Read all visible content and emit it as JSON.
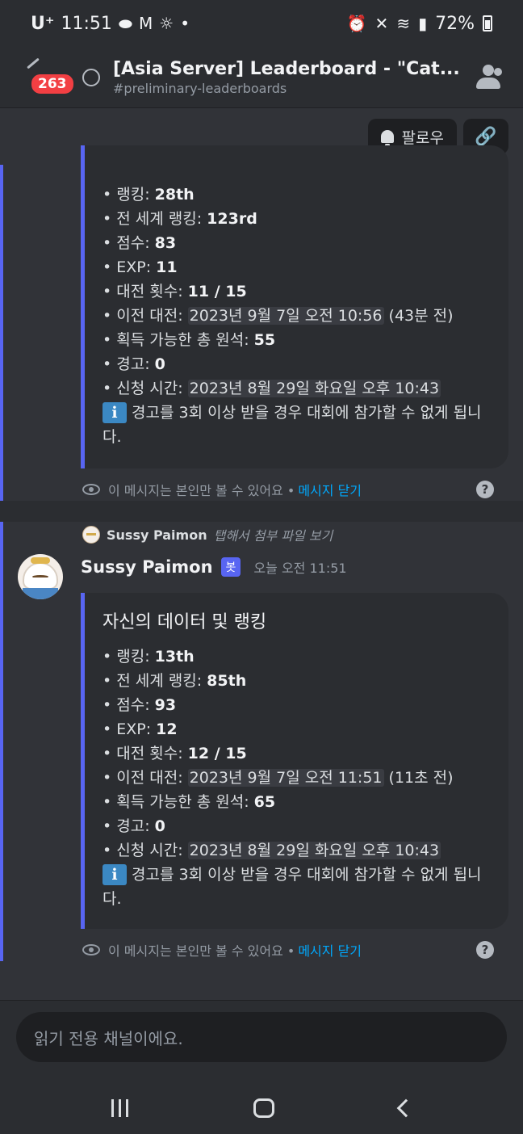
{
  "status": {
    "carrier": "U⁺",
    "time": "11:51",
    "battery": "72%"
  },
  "header": {
    "badge_count": "263",
    "title": "[Asia Server] Leaderboard - \"Cat...",
    "subtitle": "#preliminary-leaderboards"
  },
  "follow_bar": {
    "follow_label": "팔로우",
    "link_icon": "link-icon"
  },
  "message1": {
    "fields": [
      {
        "label": "• 랭킹: ",
        "value": "28th"
      },
      {
        "label": "• 전 세계 랭킹: ",
        "value": "123rd"
      },
      {
        "label": "• 점수: ",
        "value": "83"
      },
      {
        "label": "• EXP: ",
        "value": "11"
      },
      {
        "label": "• 대전 횟수: ",
        "value": "11 / 15"
      }
    ],
    "prev_match_label": "• 이전 대전: ",
    "prev_match_ts": "2023년 9월 7일 오전 10:56",
    "prev_match_rel": " (43분 전)",
    "primo_label": "• 획득 가능한 총 원석: ",
    "primo_value": "55",
    "warn_label": "• 경고: ",
    "warn_value": "0",
    "signup_label": "• 신청 시간: ",
    "signup_ts": "2023년 8월 29일 화요일 오후 10:43",
    "info_text": "경고를 3회 이상 받을 경우 대회에 참가할 수 없게 됩니다.",
    "ephemeral_text": "이 메시지는 본인만 볼 수 있어요 • ",
    "dismiss_label": "메시지 닫기"
  },
  "message2": {
    "reply_name": "Sussy Paimon",
    "reply_text": "탭해서 첨부 파일 보기",
    "author": "Sussy Paimon",
    "bot_tag": "봇",
    "time": "오늘 오전 11:51",
    "embed_title": "자신의 데이터 및 랭킹",
    "fields": [
      {
        "label": "• 랭킹: ",
        "value": "13th"
      },
      {
        "label": "• 전 세계 랭킹: ",
        "value": "85th"
      },
      {
        "label": "• 점수: ",
        "value": "93"
      },
      {
        "label": "• EXP: ",
        "value": "12"
      },
      {
        "label": "• 대전 횟수: ",
        "value": "12 / 15"
      }
    ],
    "prev_match_label": "• 이전 대전: ",
    "prev_match_ts": "2023년 9월 7일 오전 11:51",
    "prev_match_rel": " (11초 전)",
    "primo_label": "• 획득 가능한 총 원석: ",
    "primo_value": "65",
    "warn_label": "• 경고: ",
    "warn_value": "0",
    "signup_label": "• 신청 시간: ",
    "signup_ts": "2023년 8월 29일 화요일 오후 10:43",
    "info_text": "경고를 3회 이상 받을 경우 대회에 참가할 수 없게 됩니다.",
    "ephemeral_text": "이 메시지는 본인만 볼 수 있어요 • ",
    "dismiss_label": "메시지 닫기"
  },
  "input": {
    "placeholder": "읽기 전용 채널이에요."
  },
  "info_icon_glyph": "i",
  "help_glyph": "?"
}
